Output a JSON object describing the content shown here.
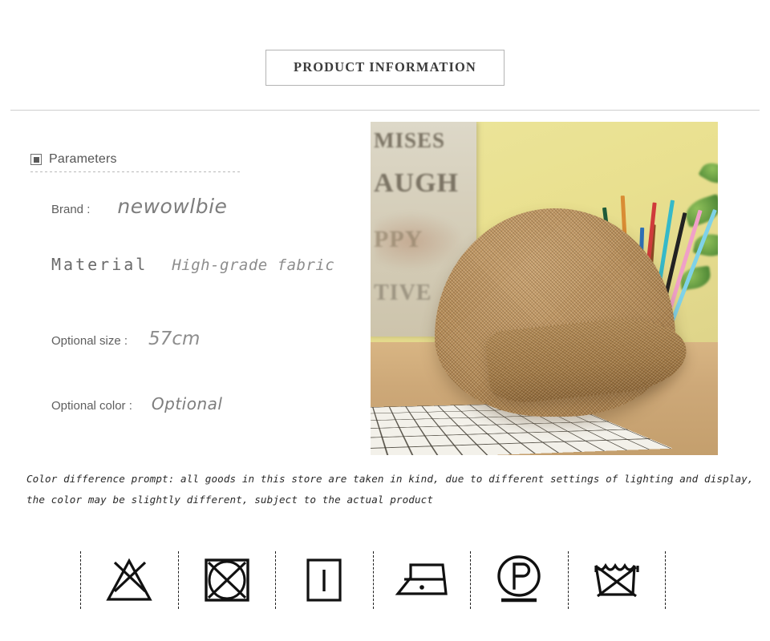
{
  "header": {
    "title": "PRODUCT INFORMATION"
  },
  "parameters": {
    "section_label": "Parameters",
    "icon": "nested-square-icon",
    "rows": [
      {
        "key": "Brand :",
        "value": "newowlbie"
      },
      {
        "key": "Material",
        "value": "High-grade fabric"
      },
      {
        "key": "Optional size :",
        "value": "57cm"
      },
      {
        "key": "Optional color :",
        "value": "Optional"
      }
    ]
  },
  "product_photo": {
    "alt": "beige woven straw hat on white mosaic tile cloth",
    "sign_text": [
      "MISES",
      "AUGH",
      "PPY",
      "TIVE"
    ],
    "wall_color": "#e9e08f",
    "hat_color": "#b88f5c",
    "table_color": "#cda878"
  },
  "color_prompt": {
    "line1": "Color difference prompt: all goods in this store are taken in kind, due to different settings of lighting and display,",
    "line2": "the color may be slightly different, subject to the actual product"
  },
  "care_symbols": [
    {
      "name": "do-not-bleach-icon",
      "label": "Do not bleach"
    },
    {
      "name": "do-not-tumble-dry-icon",
      "label": "Do not tumble dry"
    },
    {
      "name": "drip-dry-icon",
      "label": "Drip dry"
    },
    {
      "name": "iron-low-heat-icon",
      "label": "Iron low heat"
    },
    {
      "name": "dry-clean-p-icon",
      "label": "Dry clean petroleum solvent"
    },
    {
      "name": "do-not-wash-icon",
      "label": "Do not wash"
    }
  ],
  "colors": {
    "divider": "#cfcfcf",
    "text": "#555555",
    "value_text": "#8a8a8a",
    "prompt_text": "#2a2a2a"
  }
}
